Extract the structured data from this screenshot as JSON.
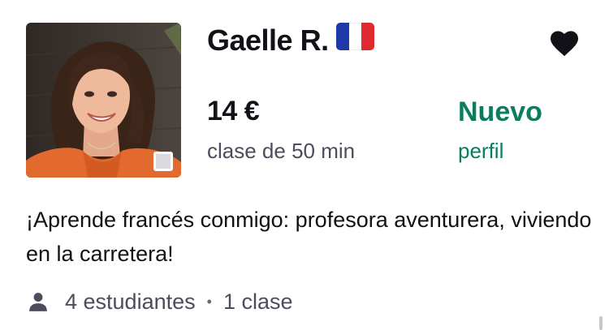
{
  "tutor": {
    "name": "Gaelle R.",
    "flag_icon": "france-flag-icon",
    "flag_colors": [
      "#1e3aa8",
      "#ffffff",
      "#e0282f"
    ],
    "price": "14 €",
    "price_subtitle": "clase de 50 min",
    "badge_title": "Nuevo",
    "badge_subtitle": "perfil",
    "headline": "¡Aprende francés conmigo: profesora aventurera, viviendo en la carretera!",
    "students": "4 estudiantes",
    "separator": "•",
    "lessons": "1 clase",
    "favorite_icon": "heart-icon"
  },
  "colors": {
    "accent_green": "#0a7d5e",
    "text_primary": "#121117",
    "text_secondary": "#4d4c5c"
  }
}
